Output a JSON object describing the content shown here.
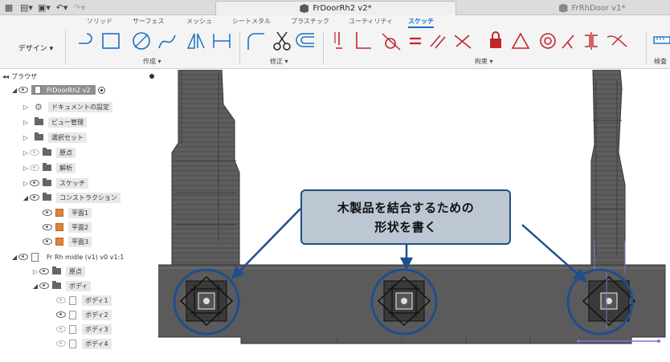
{
  "topbar": {
    "active_doc": "FrDoorRh2 v2*",
    "inactive_doc": "FrRhDoor v1*"
  },
  "ribbon": {
    "tabs": [
      "ソリッド",
      "サーフェス",
      "メッシュ",
      "シートメタル",
      "プラスチック",
      "ユーティリティ",
      "スケッチ"
    ],
    "workspace": "デザイン ▾",
    "groups": {
      "create": "作成 ▾",
      "modify": "修正 ▾",
      "constraints": "拘束 ▾",
      "inspect": "検査"
    }
  },
  "browser": {
    "title": "ブラウザ",
    "root": "FrDoorRh2 v2",
    "items": {
      "doc_settings": "ドキュメントの設定",
      "views": "ビュー管理",
      "select_sets": "選択セット",
      "origin": "原点",
      "analysis": "解析",
      "sketches": "スケッチ",
      "construction": "コンストラクション",
      "plane1": "平面1",
      "plane2": "平面2",
      "plane3": "平面3",
      "component": "Fr Rh midle (v1) v0 v1:1",
      "comp_origin": "原点",
      "bodies": "ボディ",
      "body1": "ボディ1",
      "body2": "ボディ2",
      "body3": "ボディ3",
      "body4": "ボディ4"
    }
  },
  "callout": {
    "line1": "木製品を結合するための",
    "line2": "形状を書く"
  },
  "colors": {
    "accent": "#1b6ec2",
    "callout_border": "#1f4e8c",
    "callout_fill": "#bcc7d3",
    "part": "#5a5a5a"
  }
}
